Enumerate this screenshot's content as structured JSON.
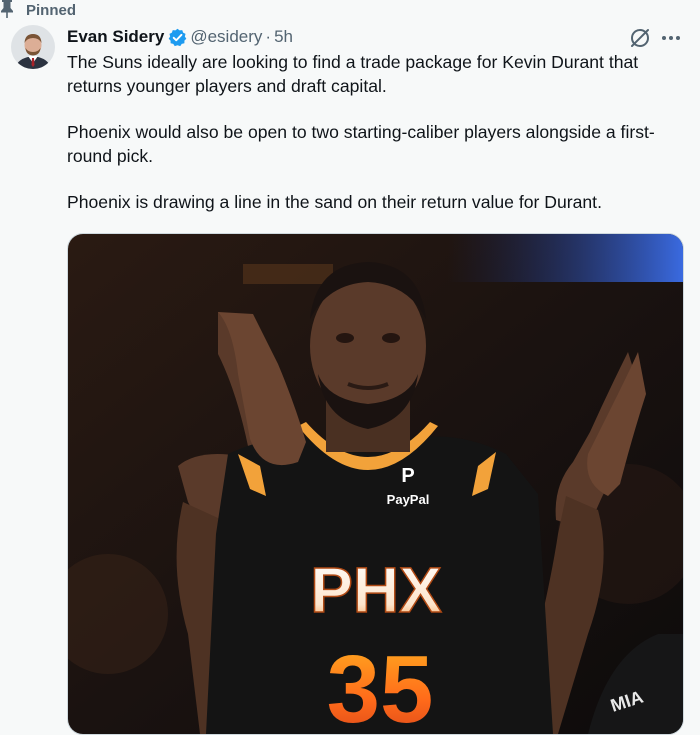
{
  "pinned": {
    "label": "Pinned",
    "icon": "pin-icon"
  },
  "author": {
    "name": "Evan Sidery",
    "handle": "@esidery",
    "separator": "·",
    "time": "5h",
    "verified_icon": "verified-badge-icon",
    "verified_color": "#1d9bf0"
  },
  "actions": {
    "grok_icon": "grok-icon",
    "more_icon": "more-icon"
  },
  "tweet": {
    "paragraphs": [
      "The Suns ideally are looking to find a trade package for Kevin Durant that returns younger players and draft capital.",
      "Phoenix would also be open to two starting-caliber players alongside a first-round pick.",
      "Phoenix is drawing a line in the sand on their return value for Durant."
    ]
  },
  "media": {
    "jersey_sponsor": "PayPal",
    "jersey_team": "PHX",
    "jersey_number": "35"
  },
  "colors": {
    "text": "#0f1419",
    "secondary": "#536471",
    "background": "#f7f9f9"
  }
}
